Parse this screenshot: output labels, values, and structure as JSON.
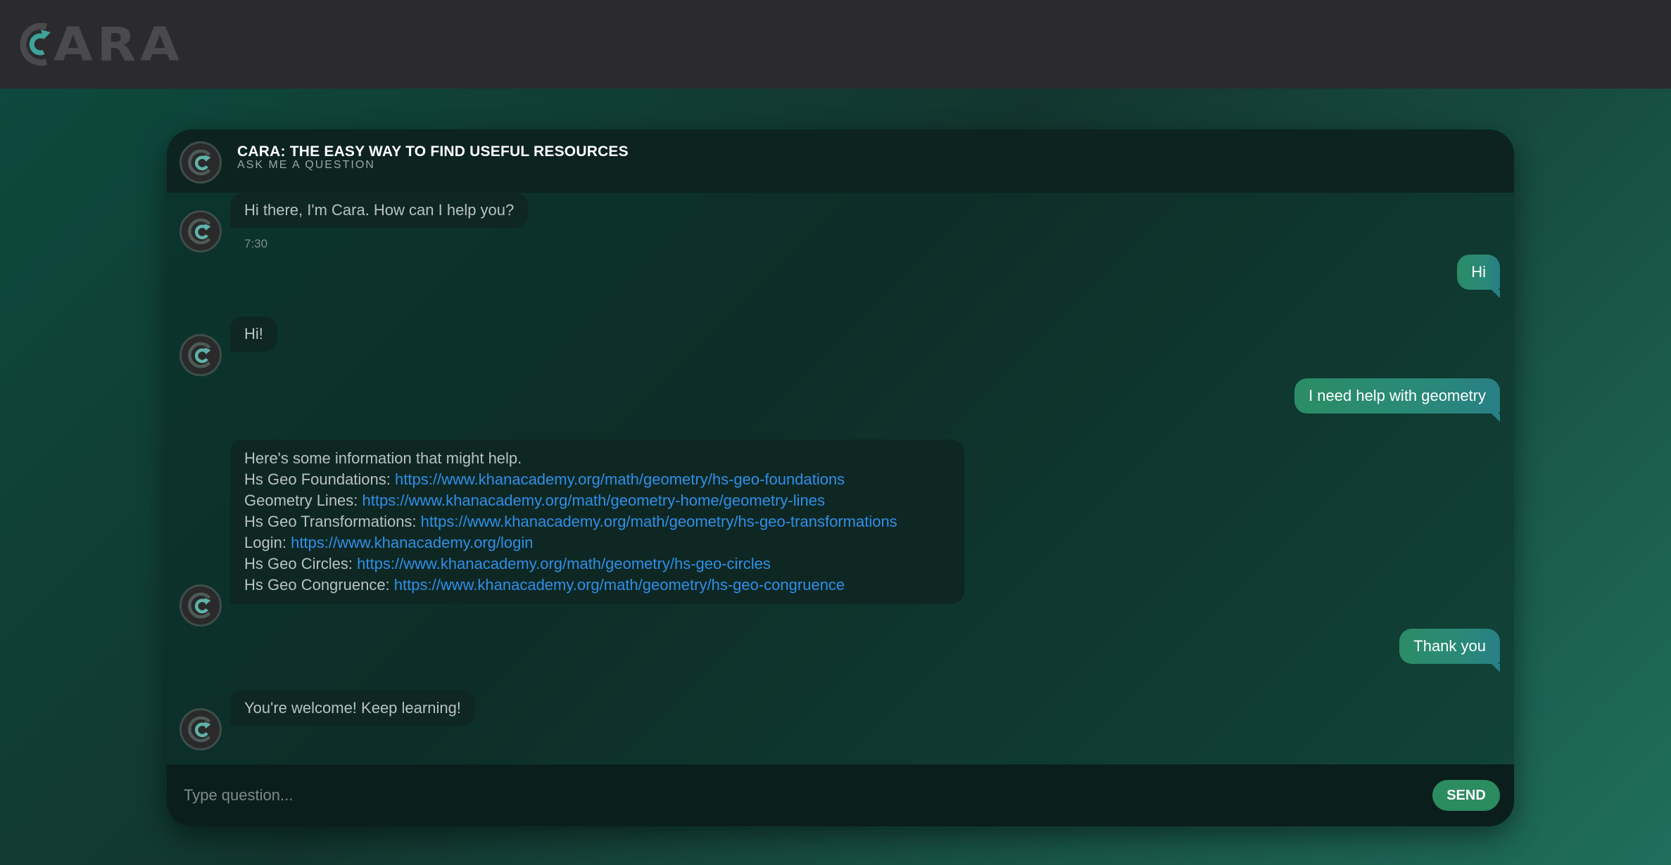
{
  "app": {
    "logo_text": "ARA"
  },
  "header": {
    "title": "CARA: THE EASY WAY TO FIND USEFUL RESOURCES",
    "subtitle": "ASK ME A QUESTION"
  },
  "messages": [
    {
      "from": "bot",
      "text": "Hi there, I'm Cara. How can I help you?",
      "time": "7:30"
    },
    {
      "from": "user",
      "text": "Hi"
    },
    {
      "from": "bot",
      "text": "Hi!"
    },
    {
      "from": "user",
      "text": "I need help with geometry"
    },
    {
      "from": "bot",
      "intro": "Here's some information that might help.",
      "resources": [
        {
          "label": "Hs Geo Foundations:",
          "url": "https://www.khanacademy.org/math/geometry/hs-geo-foundations"
        },
        {
          "label": "Geometry Lines:",
          "url": "https://www.khanacademy.org/math/geometry-home/geometry-lines"
        },
        {
          "label": "Hs Geo Transformations:",
          "url": "https://www.khanacademy.org/math/geometry/hs-geo-transformations"
        },
        {
          "label": "Login:",
          "url": "https://www.khanacademy.org/login"
        },
        {
          "label": "Hs Geo Circles:",
          "url": "https://www.khanacademy.org/math/geometry/hs-geo-circles"
        },
        {
          "label": "Hs Geo Congruence:",
          "url": "https://www.khanacademy.org/math/geometry/hs-geo-congruence"
        }
      ]
    },
    {
      "from": "user",
      "text": "Thank you"
    },
    {
      "from": "bot",
      "text": "You're welcome! Keep learning!"
    }
  ],
  "input": {
    "placeholder": "Type question...",
    "value": ""
  },
  "send_button": {
    "label": "SEND"
  },
  "colors": {
    "accent": "#2a8c5f",
    "link": "#2f8fe8",
    "topbar": "#2b2b2d"
  },
  "icons": {
    "avatar": "cara-logo-icon"
  }
}
